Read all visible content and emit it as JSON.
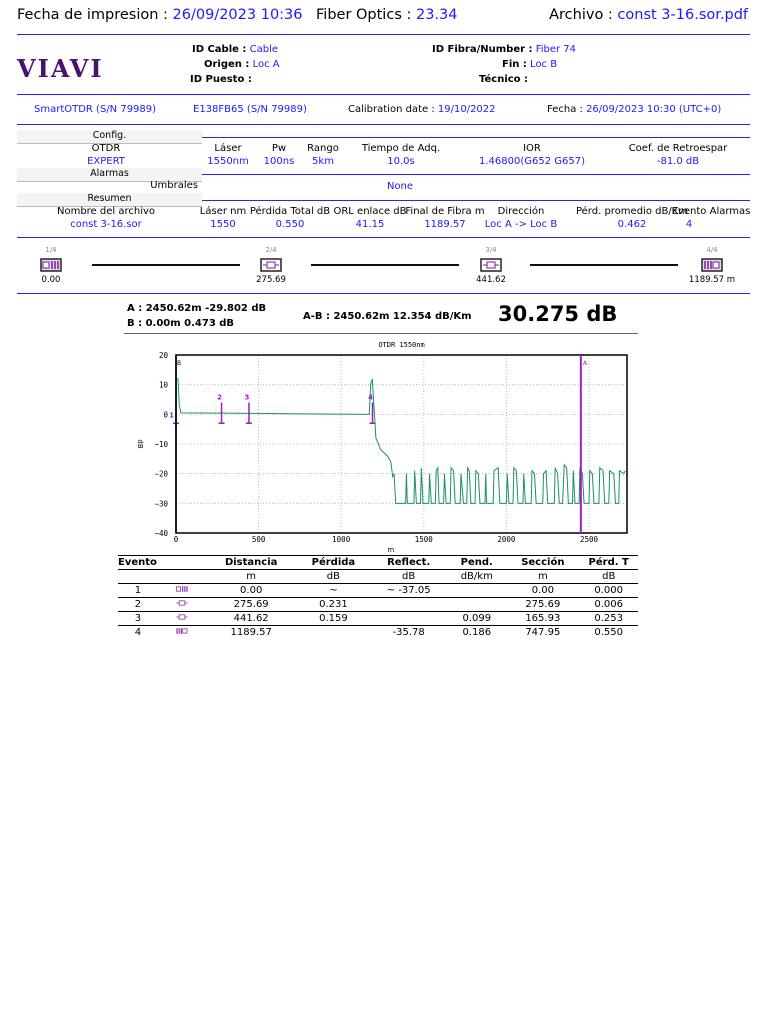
{
  "header": {
    "print_date_label": "Fecha de impresion :",
    "print_date": "26/09/2023 10:36",
    "company_label": "Fiber Optics :",
    "company_value": "23.34",
    "file_label": "Archivo :",
    "file_value": "const 3-16.sor.pdf"
  },
  "logo": "VIAVI",
  "ids": {
    "cable_label": "ID Cable :",
    "cable": "Cable",
    "origin_label": "Origen :",
    "origin": "Loc A",
    "post_label": "ID Puesto :",
    "fiber_label": "ID Fibra/Number :",
    "fiber": "Fiber 74",
    "end_label": "Fin :",
    "end": "Loc B",
    "tech_label": "Técnico :"
  },
  "device": {
    "model": "SmartOTDR (S/N 79989)",
    "module": "E138FB65 (S/N 79989)",
    "calib_label": "Calibration date :",
    "calib": "19/10/2022",
    "date_label": "Fecha :",
    "date": "26/09/2023 10:30 (UTC+0)"
  },
  "config": {
    "section": "Config.",
    "mode_label": "OTDR",
    "mode": "EXPERT",
    "cols": [
      {
        "h": "Láser",
        "v": "1550nm"
      },
      {
        "h": "Pw",
        "v": "100ns"
      },
      {
        "h": "Rango",
        "v": "5km"
      },
      {
        "h": "Tiempo de Adq.",
        "v": "10.0s"
      },
      {
        "h": "IOR",
        "v": "1.46800(G652 G657)"
      },
      {
        "h": "Coef. de Retroespar",
        "v": "-81.0 dB"
      }
    ]
  },
  "alarms": {
    "section": "Alarmas",
    "thresholds_label": "Umbrales",
    "thresholds": "None"
  },
  "summary": {
    "section": "Resumen",
    "file_label": "Nombre del archivo",
    "file": "const 3-16.sor",
    "cols": [
      {
        "h": "Láser nm",
        "v": "1550"
      },
      {
        "h": "Pérdida Total dB",
        "v": "0.550"
      },
      {
        "h": "ORL enlace dB",
        "v": "41.15"
      },
      {
        "h": "Final de Fibra m",
        "v": "1189.57"
      },
      {
        "h": "Dirección",
        "v": "Loc A -> Loc B"
      },
      {
        "h": "Pérd. promedio dB/Km",
        "v": "0.462"
      },
      {
        "h": "Evento",
        "v": "4"
      },
      {
        "h": "Alarmas",
        "v": ""
      }
    ]
  },
  "linkmap": [
    {
      "idx": "1/4",
      "dist": "0.00",
      "icon": "launch-icon"
    },
    {
      "idx": "2/4",
      "dist": "275.69",
      "icon": "splice-icon"
    },
    {
      "idx": "3/4",
      "dist": "441.62",
      "icon": "splice-icon"
    },
    {
      "idx": "4/4",
      "dist": "1189.57 m",
      "icon": "end-icon"
    }
  ],
  "cursors": {
    "a": "A : 2450.62m -29.802 dB",
    "b": "B : 0.00m 0.473 dB",
    "ab": "A-B : 2450.62m 12.354 dB/Km",
    "loss": "30.275 dB",
    "a_color": "#ff0000",
    "b_color": "#0000ff"
  },
  "chart_data": {
    "type": "line",
    "title": "OTDR 1550nm",
    "xlabel": "m",
    "ylabel": "dB",
    "xlim": [
      0,
      2730
    ],
    "ylim": [
      -40,
      20
    ],
    "xticks": [
      "0",
      "500",
      "1000",
      "1500",
      "2000",
      "2500"
    ],
    "yticks": [
      "20",
      "10",
      "0",
      "−10",
      "−20",
      "−30",
      "−40"
    ],
    "grid": true,
    "trace_color": "#1f8f6a",
    "trace": [
      [
        0,
        -8
      ],
      [
        3,
        12
      ],
      [
        12,
        12
      ],
      [
        20,
        3
      ],
      [
        30,
        0.5
      ],
      [
        300,
        0.4
      ],
      [
        700,
        0.2
      ],
      [
        1170,
        0
      ],
      [
        1178,
        10
      ],
      [
        1188,
        12
      ],
      [
        1198,
        3
      ],
      [
        1210,
        -8
      ],
      [
        1240,
        -12
      ],
      [
        1280,
        -14
      ],
      [
        1300,
        -16
      ],
      [
        1312,
        -21
      ],
      [
        1320,
        -20
      ],
      [
        1330,
        -30
      ],
      [
        1390,
        -30
      ],
      [
        1395,
        -20
      ],
      [
        1400,
        -30
      ],
      [
        1440,
        -30
      ],
      [
        1445,
        -19
      ],
      [
        1455,
        -30
      ],
      [
        1480,
        -30
      ],
      [
        1485,
        -18
      ],
      [
        1495,
        -30
      ],
      [
        1530,
        -30
      ],
      [
        1535,
        -20
      ],
      [
        1545,
        -30
      ],
      [
        1570,
        -30
      ],
      [
        1575,
        -19
      ],
      [
        1585,
        -18
      ],
      [
        1592,
        -30
      ],
      [
        1620,
        -30
      ],
      [
        1625,
        -20
      ],
      [
        1635,
        -30
      ],
      [
        1660,
        -30
      ],
      [
        1665,
        -18
      ],
      [
        1680,
        -19
      ],
      [
        1690,
        -30
      ],
      [
        1720,
        -30
      ],
      [
        1725,
        -20
      ],
      [
        1740,
        -30
      ],
      [
        1760,
        -30
      ],
      [
        1765,
        -18
      ],
      [
        1775,
        -19
      ],
      [
        1785,
        -30
      ],
      [
        1810,
        -30
      ],
      [
        1815,
        -19
      ],
      [
        1830,
        -20
      ],
      [
        1840,
        -30
      ],
      [
        1870,
        -30
      ],
      [
        1875,
        -20
      ],
      [
        1880,
        -30
      ],
      [
        1920,
        -30
      ],
      [
        1925,
        -19
      ],
      [
        1950,
        -18
      ],
      [
        1960,
        -30
      ],
      [
        2000,
        -30
      ],
      [
        2005,
        -20
      ],
      [
        2015,
        -30
      ],
      [
        2040,
        -30
      ],
      [
        2045,
        -18
      ],
      [
        2060,
        -19
      ],
      [
        2070,
        -30
      ],
      [
        2100,
        -30
      ],
      [
        2105,
        -20
      ],
      [
        2115,
        -30
      ],
      [
        2150,
        -30
      ],
      [
        2155,
        -19
      ],
      [
        2170,
        -20
      ],
      [
        2180,
        -30
      ],
      [
        2220,
        -30
      ],
      [
        2225,
        -20
      ],
      [
        2240,
        -19
      ],
      [
        2250,
        -30
      ],
      [
        2290,
        -30
      ],
      [
        2295,
        -18
      ],
      [
        2310,
        -20
      ],
      [
        2320,
        -30
      ],
      [
        2340,
        -30
      ],
      [
        2350,
        -17
      ],
      [
        2365,
        -18
      ],
      [
        2375,
        -30
      ],
      [
        2400,
        -30
      ],
      [
        2405,
        -19
      ],
      [
        2415,
        -30
      ],
      [
        2440,
        -30
      ],
      [
        2445,
        -18
      ],
      [
        2460,
        -20
      ],
      [
        2470,
        -30
      ],
      [
        2500,
        -30
      ],
      [
        2505,
        -19
      ],
      [
        2520,
        -20
      ],
      [
        2530,
        -30
      ],
      [
        2560,
        -30
      ],
      [
        2565,
        -18
      ],
      [
        2585,
        -19
      ],
      [
        2595,
        -30
      ],
      [
        2620,
        -30
      ],
      [
        2625,
        -19
      ],
      [
        2650,
        -20
      ],
      [
        2660,
        -30
      ],
      [
        2680,
        -30
      ],
      [
        2685,
        -19
      ],
      [
        2710,
        -20
      ],
      [
        2720,
        -19
      ]
    ],
    "events": [
      {
        "label": "1",
        "x": 0
      },
      {
        "label": "2",
        "x": 275.69
      },
      {
        "label": "3",
        "x": 441.62
      },
      {
        "label": "4",
        "x": 1189.57
      }
    ],
    "cursor_a": {
      "label": "A",
      "x": 2450.62
    },
    "cursor_b": {
      "label": "B",
      "x": 0
    },
    "event_color": "#9a1fc0"
  },
  "table": {
    "headers": [
      "Evento",
      "",
      "Distancia",
      "Pérdida",
      "Reflect.",
      "Pend.",
      "Sección",
      "Pérd. T"
    ],
    "units": [
      "",
      "",
      "m",
      "dB",
      "dB",
      "dB/km",
      "m",
      "dB"
    ],
    "rows": [
      [
        "1",
        "launch-icon",
        "0.00",
        "~",
        "~ -37.05",
        "",
        "0.00",
        "0.000"
      ],
      [
        "2",
        "splice-icon",
        "275.69",
        "0.231",
        "",
        "",
        "275.69",
        "0.006"
      ],
      [
        "3",
        "splice-icon",
        "441.62",
        "0.159",
        "",
        "0.099",
        "165.93",
        "0.253"
      ],
      [
        "4",
        "end-icon",
        "1189.57",
        "",
        "-35.78",
        "0.186",
        "747.95",
        "0.550"
      ]
    ]
  }
}
